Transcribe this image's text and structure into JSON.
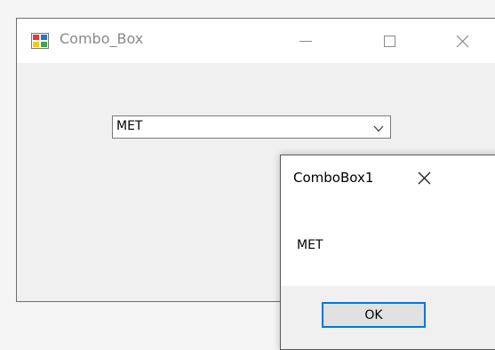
{
  "window": {
    "title": "Combo_Box",
    "icon": "winforms-app-icon",
    "controls": [
      "minimize-icon",
      "maximize-icon",
      "close-icon"
    ]
  },
  "combobox": {
    "value": "MET",
    "icon": "chevron-down-icon"
  },
  "messagebox": {
    "title": "ComboBox1",
    "message": "MET",
    "ok_label": "OK",
    "close_icon": "close-icon"
  },
  "colors": {
    "accent": "#0078d7",
    "form_background": "#f0f0f0",
    "titlebar_background": "#ffffff"
  }
}
